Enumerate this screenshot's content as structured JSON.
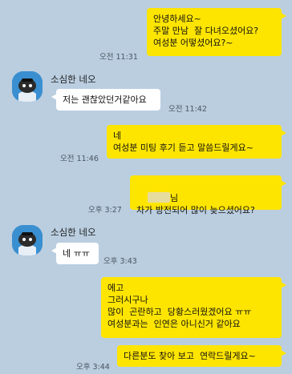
{
  "colors": {
    "background": "#bacee0",
    "outgoing_bubble": "#fee500",
    "incoming_bubble": "#ffffff",
    "avatar_bg": "#3a8fd0"
  },
  "messages": {
    "m1": {
      "text": "안녕하세요~\n주말 만남  잘 다녀오셨어요?\n여성분 어떻셨어요?~",
      "time": "오전 11:31"
    },
    "m2": {
      "sender": "소심한 네오",
      "text": "저는 괜찮았던거같아요",
      "time": "오전 11:42"
    },
    "m3": {
      "text": "네\n여성분 미팅 후기 듣고 말씀드릴게요~",
      "time": "오전 11:46"
    },
    "m4": {
      "name_suffix": "님",
      "text": "차가 방전되어 많이 늦으셨어요?",
      "time": "오후 3:27"
    },
    "m5": {
      "sender": "소심한 네오",
      "text": "네 ㅠㅠ",
      "time": "오후 3:43"
    },
    "m6": {
      "text": "에고\n그러시구나\n많이  곤란하고  당황스러웠겠어요 ㅠㅠ\n여성분과는  인연은 아니신거 같아요",
      "time": ""
    },
    "m7": {
      "text": "다른분도 찾아 보고  연락드릴게요~",
      "time": "오후 3:44"
    }
  }
}
